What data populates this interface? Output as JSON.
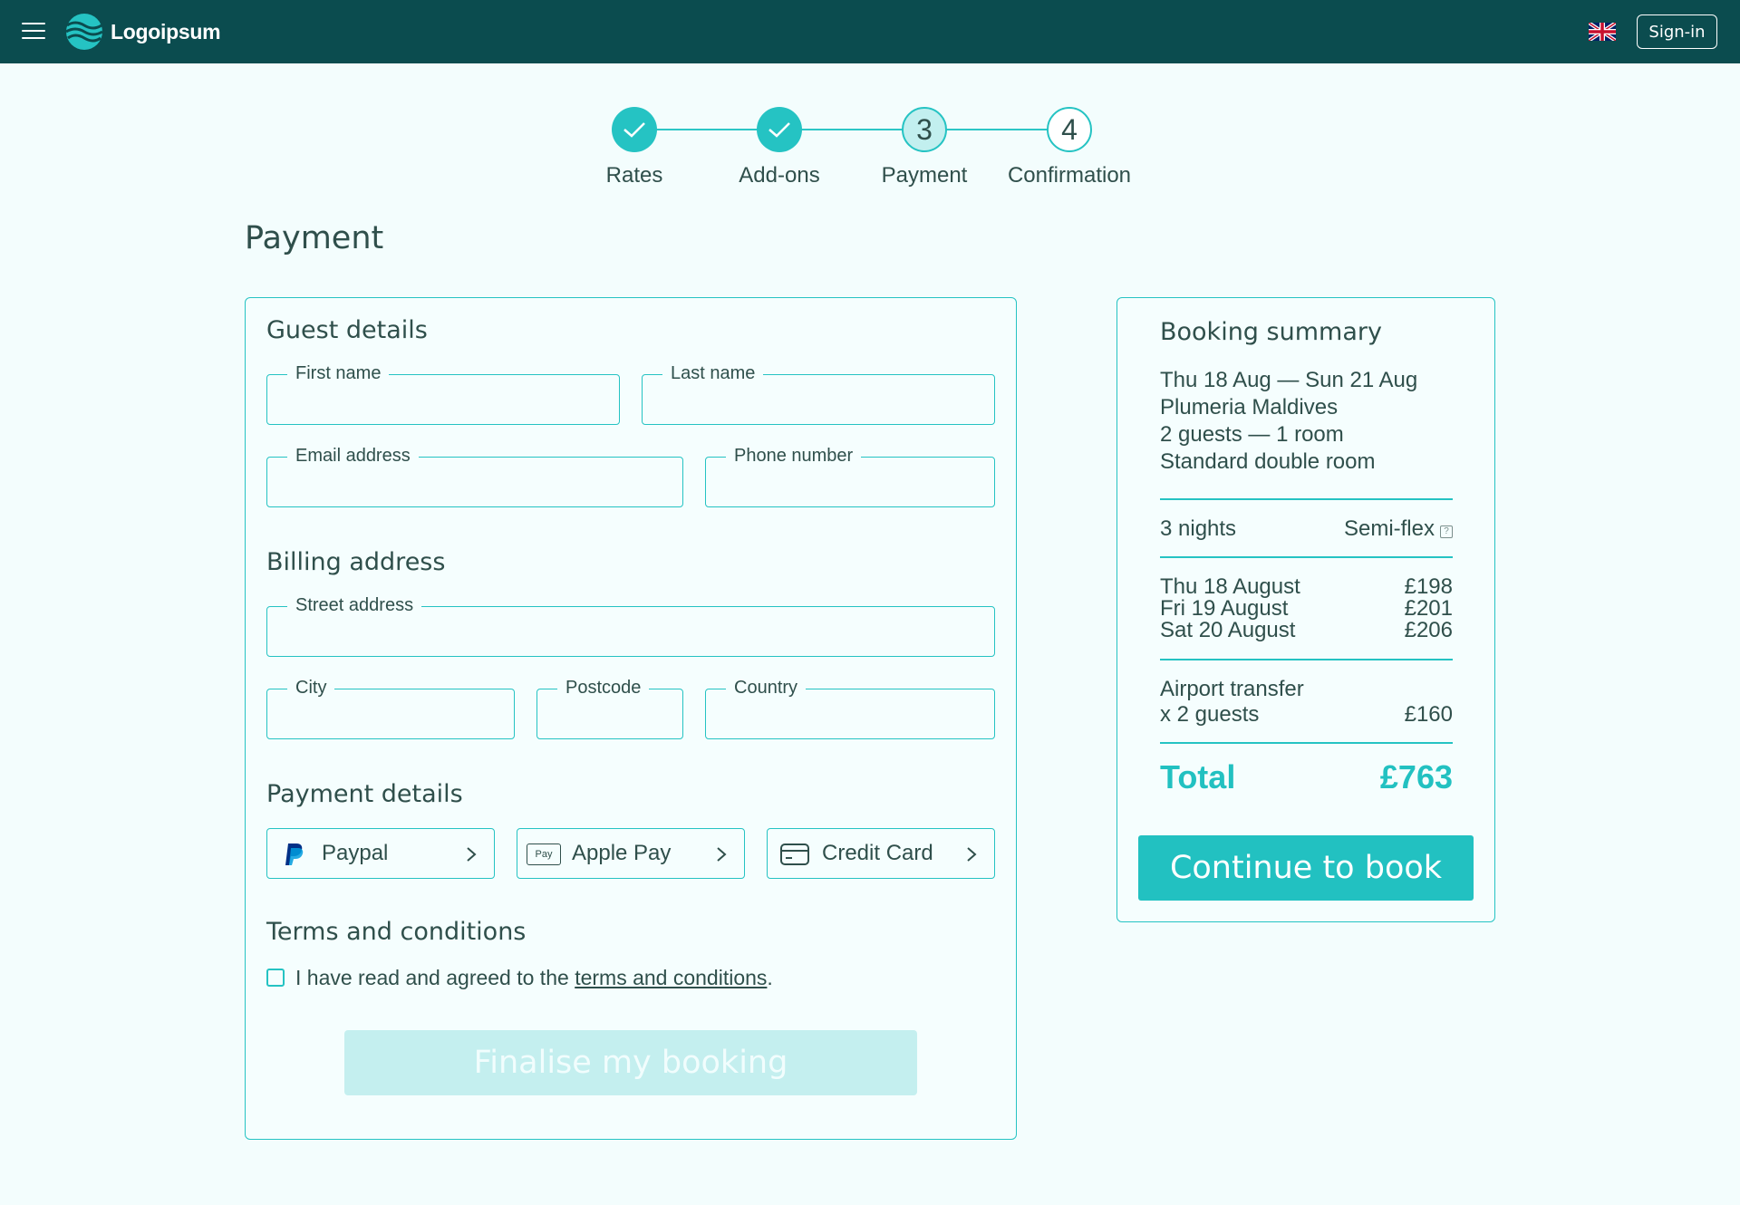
{
  "header": {
    "logo_text": "Logoipsum",
    "signin_label": "Sign-in"
  },
  "stepper": {
    "steps": [
      {
        "label": "Rates",
        "number": "1",
        "state": "done"
      },
      {
        "label": "Add-ons",
        "number": "2",
        "state": "done"
      },
      {
        "label": "Payment",
        "number": "3",
        "state": "current"
      },
      {
        "label": "Confirmation",
        "number": "4",
        "state": "todo"
      }
    ]
  },
  "page": {
    "title": "Payment"
  },
  "guest": {
    "title": "Guest details",
    "first_name_label": "First name",
    "last_name_label": "Last name",
    "email_label": "Email address",
    "phone_label": "Phone number"
  },
  "billing": {
    "title": "Billing address",
    "street_label": "Street address",
    "city_label": "City",
    "postcode_label": "Postcode",
    "country_label": "Country"
  },
  "payment": {
    "title": "Payment details",
    "options": [
      {
        "label": "Paypal",
        "icon": "paypal-icon"
      },
      {
        "label": "Apple Pay",
        "icon": "apple-pay-icon"
      },
      {
        "label": "Credit Card",
        "icon": "credit-card-icon"
      }
    ],
    "apple_pay_badge": "Pay"
  },
  "terms": {
    "title": "Terms and conditions",
    "text_before": "I have read and agreed to the ",
    "link": "terms and conditions",
    "text_after": "."
  },
  "finalise_label": "Finalise my booking",
  "summary": {
    "title": "Booking summary",
    "dates": "Thu 18 Aug — Sun 21 Aug",
    "hotel": "Plumeria Maldives",
    "guests": "2 guests — 1 room",
    "room": "Standard double room",
    "nights": "3 nights",
    "rate": "Semi-flex",
    "rate_info_icon": "?",
    "nightly": [
      {
        "date": "Thu 18 August",
        "price": "£198"
      },
      {
        "date": "Fri 19 August",
        "price": "£201"
      },
      {
        "date": "Sat 20 August",
        "price": "£206"
      }
    ],
    "addon_line1": "Airport transfer",
    "addon_line2": "x 2 guests",
    "addon_price": "£160",
    "total_label": "Total",
    "total_value": "£763",
    "continue_label": "Continue to book"
  },
  "colors": {
    "header_bg": "#0b4c4f",
    "accent": "#25c3c3",
    "page_bg": "#f3fdfd",
    "text": "#2f4f4b"
  }
}
